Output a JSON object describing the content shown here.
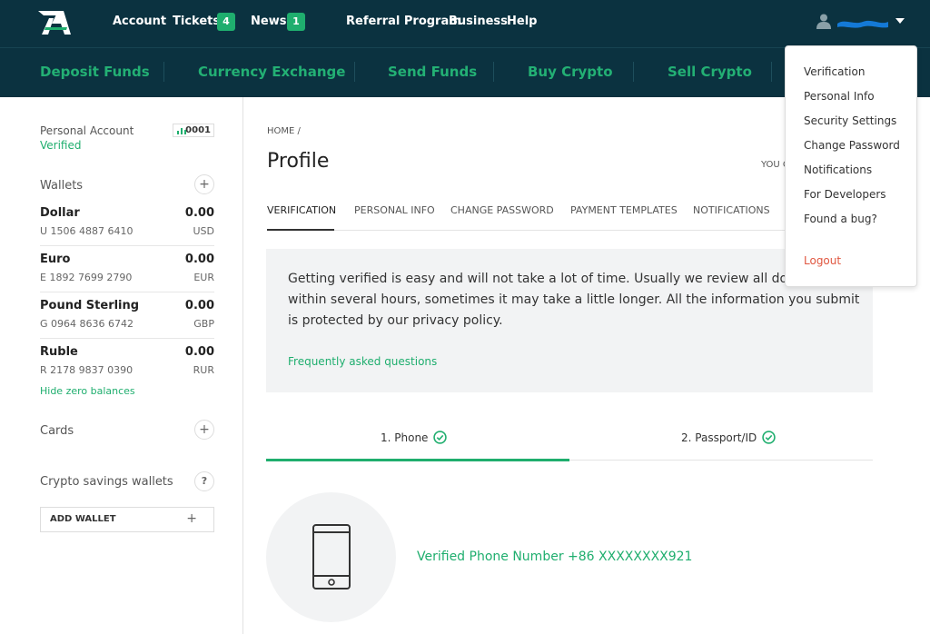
{
  "header": {
    "nav": [
      {
        "label": "Account"
      },
      {
        "label": "Tickets",
        "badge": "4"
      },
      {
        "label": "News",
        "badge": "1"
      },
      {
        "label": "Referral Program"
      },
      {
        "label": "Business"
      },
      {
        "label": "Help"
      }
    ],
    "subnav": [
      "Deposit Funds",
      "Currency Exchange",
      "Send Funds",
      "Buy Crypto",
      "Sell Crypto"
    ],
    "user_menu": {
      "items": [
        "Verification",
        "Personal Info",
        "Security Settings",
        "Change Password",
        "Notifications",
        "For Developers",
        "Found a bug?"
      ],
      "logout": "Logout"
    }
  },
  "sidebar": {
    "account_type": "Personal Account",
    "status": "Verified",
    "account_number": "0001",
    "wallets_title": "Wallets",
    "wallets": [
      {
        "name": "Dollar",
        "amount": "0.00",
        "id": "U 1506 4887 6410",
        "currency": "USD"
      },
      {
        "name": "Euro",
        "amount": "0.00",
        "id": "E 1892 7699 2790",
        "currency": "EUR"
      },
      {
        "name": "Pound Sterling",
        "amount": "0.00",
        "id": "G 0964 8636 6742",
        "currency": "GBP"
      },
      {
        "name": "Ruble",
        "amount": "0.00",
        "id": "R 2178 9837 0390",
        "currency": "RUR"
      }
    ],
    "hide_zero": "Hide zero balances",
    "cards_title": "Cards",
    "crypto_title": "Crypto savings wallets",
    "help_symbol": "?",
    "add_wallet": "ADD WALLET"
  },
  "main": {
    "breadcrumb": "HOME /",
    "title": "Profile",
    "you_text": "YOU C",
    "tabs": [
      "VERIFICATION",
      "PERSONAL INFO",
      "CHANGE PASSWORD",
      "PAYMENT TEMPLATES",
      "NOTIFICATIONS"
    ],
    "info_text": "Getting verified is easy and will not take a lot of time. Usually we review all documents within several hours, sometimes it may take a little longer. All the information you submit is protected by our privacy policy.",
    "faq": "Frequently asked questions",
    "steps": [
      "1. Phone",
      "2. Passport/ID"
    ],
    "verified_phone": "Verified Phone Number +86 XXXXXXXX921"
  },
  "colors": {
    "header_bg": "#0b3240",
    "accent": "#1fae6e",
    "logout": "#e0563f"
  }
}
